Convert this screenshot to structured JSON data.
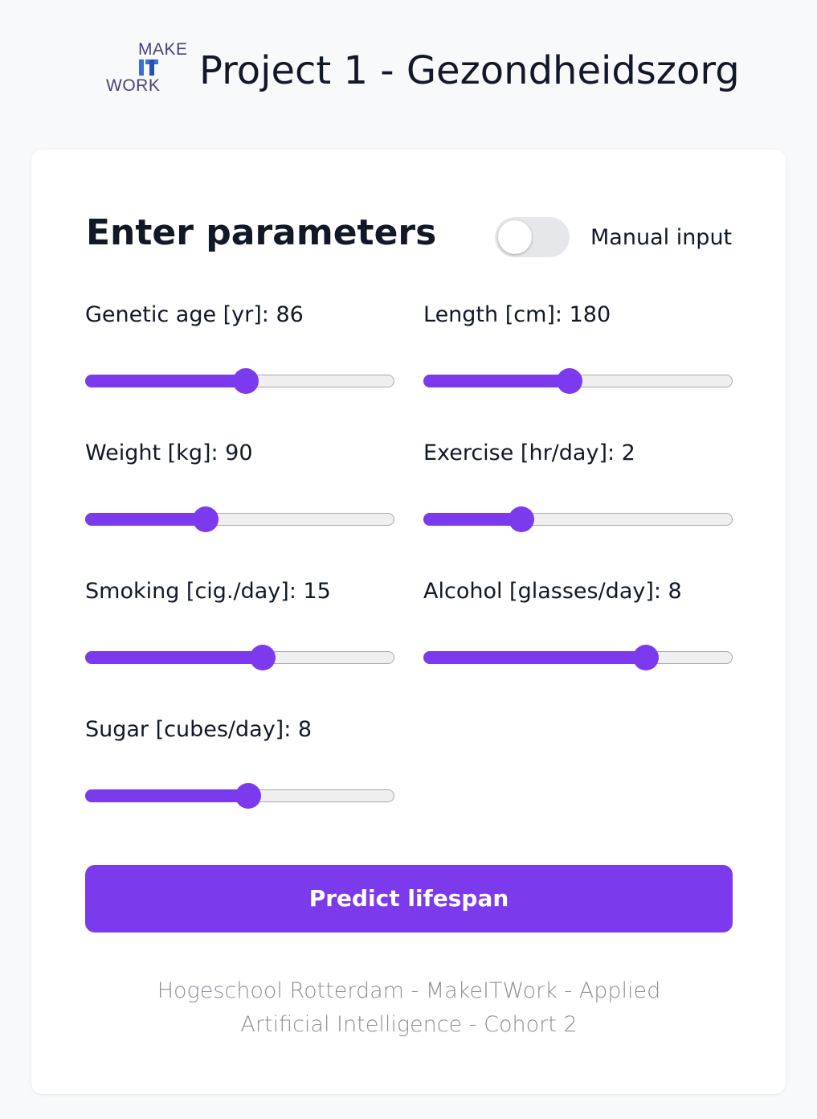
{
  "header": {
    "logo": {
      "make": "MAKE",
      "it": "IT",
      "work": "WORK"
    },
    "title": "Project 1 - Gezondheidszorg"
  },
  "card": {
    "title": "Enter parameters",
    "manual_toggle": {
      "label": "Manual input",
      "on": false
    }
  },
  "params": [
    {
      "label": "Genetic age [yr]: 86",
      "fraction": 0.52
    },
    {
      "label": "Length [cm]: 180",
      "fraction": 0.47
    },
    {
      "label": "Weight [kg]: 90",
      "fraction": 0.38
    },
    {
      "label": "Exercise [hr/day]: 2",
      "fraction": 0.3
    },
    {
      "label": "Smoking [cig./day]: 15",
      "fraction": 0.58
    },
    {
      "label": "Alcohol [glasses/day]: 8",
      "fraction": 0.74
    },
    {
      "label": "Sugar [cubes/day]: 8",
      "fraction": 0.53
    }
  ],
  "predict_button": "Predict lifespan",
  "footer": "Hogeschool Rotterdam - MakeITWork - Applied Artificial Intelligence - Cohort 2",
  "colors": {
    "accent": "#7c3aed",
    "track": "#efefef",
    "background": "#f8f9fb"
  }
}
